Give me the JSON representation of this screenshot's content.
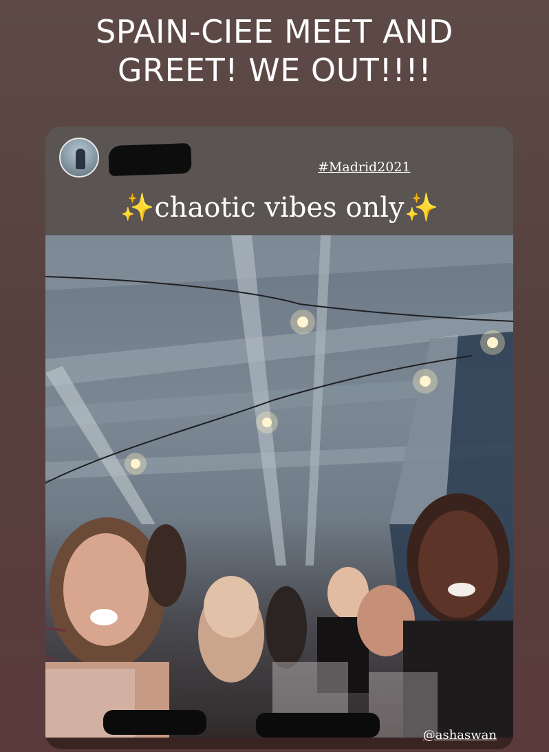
{
  "story": {
    "caption_line1": "SPAIN-CIEE MEET AND",
    "caption_line2": "GREET! WE OUT!!!!"
  },
  "repost": {
    "hashtag": "#Madrid2021",
    "sparkle_left": "✨",
    "vibes": "chaotic vibes only",
    "sparkle_right": "✨",
    "mention": "@ashaswan"
  },
  "colors": {
    "background": "#5a4543",
    "card": "#595250",
    "sparkle": "#f4d24a",
    "redaction": "#0b0b0b"
  }
}
